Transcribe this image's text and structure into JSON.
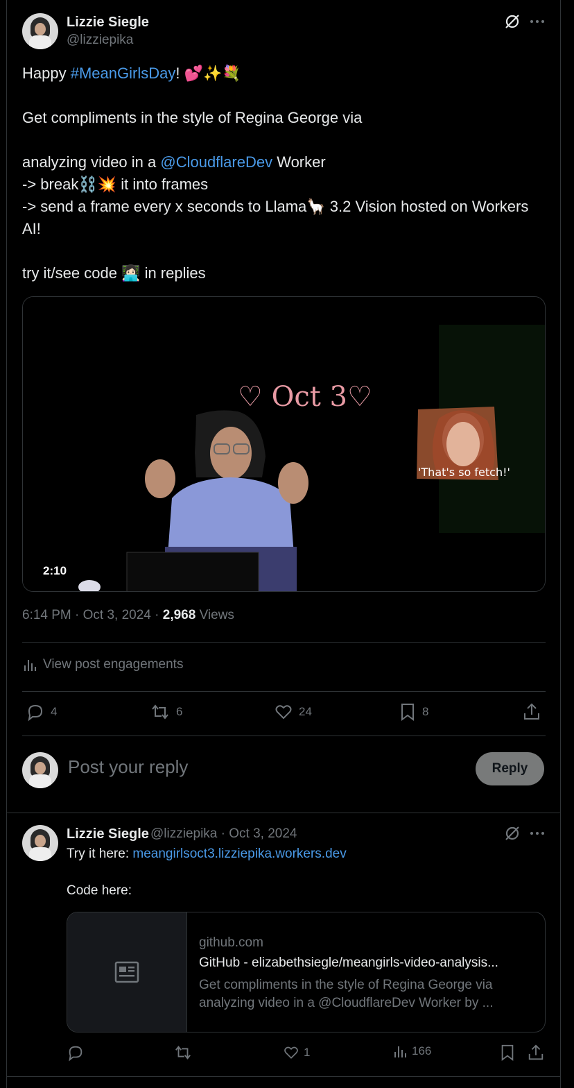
{
  "tweet": {
    "author_name": "Lizzie Siegle",
    "author_handle": "@lizziepika",
    "line1_pre": "Happy ",
    "line1_hashtag": "#MeanGirlsDay",
    "line1_post": "! 💕✨💐",
    "line2": "Get compliments in the style of Regina George via",
    "line3_pre": "analyzing video in a ",
    "line3_mention": "@CloudflareDev",
    "line3_post": " Worker",
    "line4": "-> break⛓️💥 it into frames",
    "line5": "-> send a frame every x seconds to Llama🦙 3.2 Vision hosted on Workers AI!",
    "line6": "try it/see code 👩🏻‍💻 in replies",
    "media": {
      "drawn_text": "♡ Oct 3♡",
      "sticker_caption": "'That's so fetch!'",
      "duration": "2:10"
    },
    "time": "6:14 PM · Oct 3, 2024 · ",
    "views_count": "2,968",
    "views_label": " Views",
    "engagements_label": "View post engagements",
    "replies": "4",
    "reposts": "6",
    "likes": "24",
    "bookmarks": "8"
  },
  "composer": {
    "placeholder": "Post your reply",
    "button": "Reply"
  },
  "reply": {
    "author_name": "Lizzie Siegle",
    "meta": "@lizziepika · Oct 3, 2024",
    "try_label": "Try it here: ",
    "try_link": "meangirlsoct3.lizziepika.workers.dev",
    "code_label": "Code here:",
    "card": {
      "domain": "github.com",
      "title": "GitHub - elizabethsiegle/meangirls-video-analysis...",
      "description": "Get compliments in the style of Regina George via analyzing video in a @CloudflareDev Worker by ..."
    },
    "likes": "1",
    "views": "166"
  },
  "colors": {
    "background": "#000000",
    "text": "#e7e9ea",
    "muted": "#71767b",
    "link": "#4a9ae8",
    "border": "#2f3336"
  }
}
